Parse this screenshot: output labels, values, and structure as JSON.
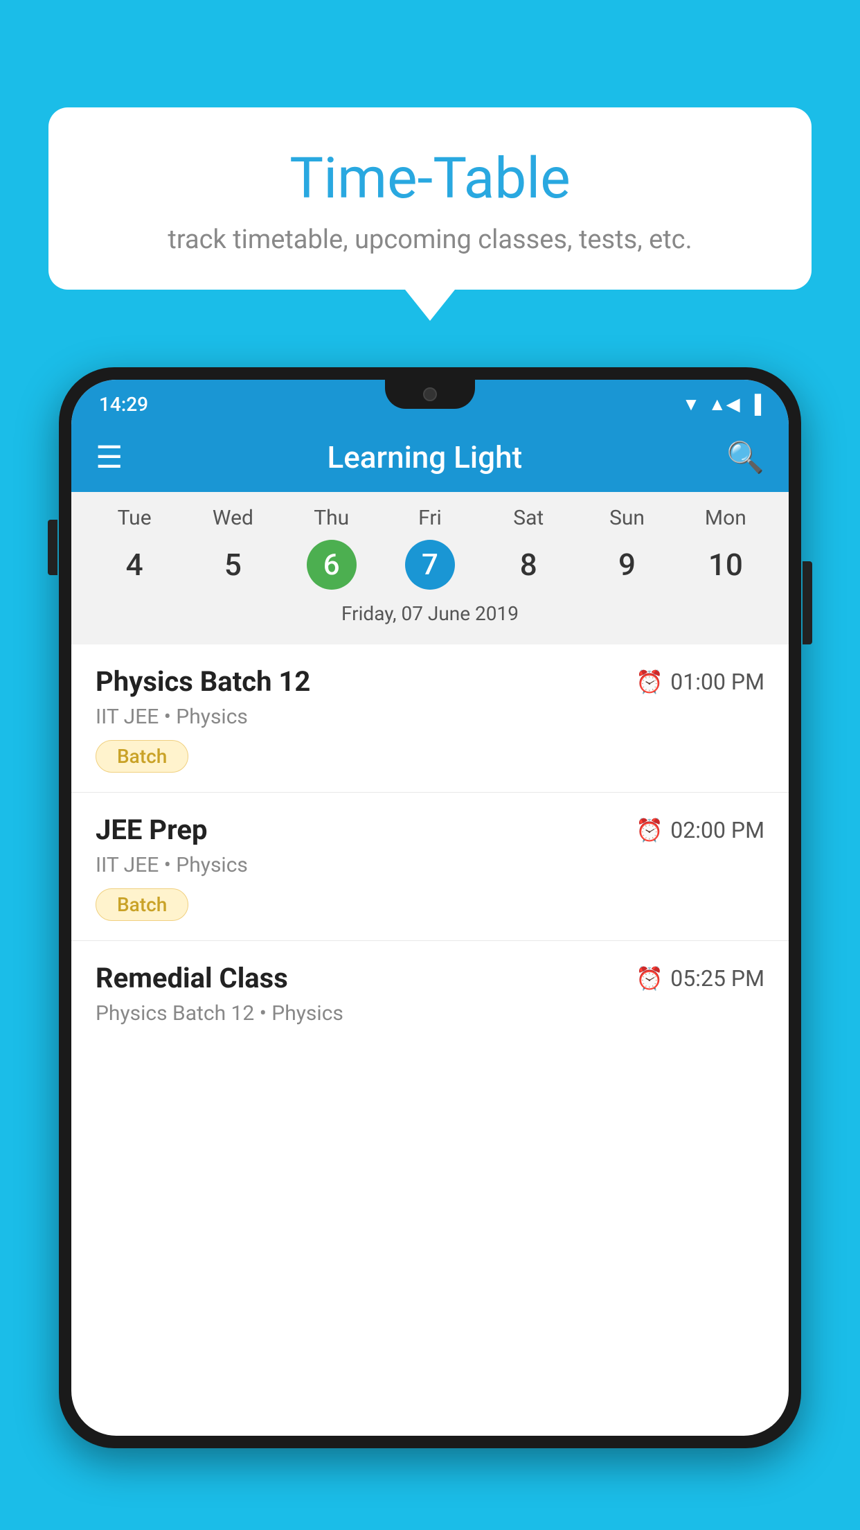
{
  "background_color": "#1BBDE8",
  "speech_bubble": {
    "title": "Time-Table",
    "subtitle": "track timetable, upcoming classes, tests, etc."
  },
  "phone": {
    "status_bar": {
      "time": "14:29",
      "icons": [
        "wifi",
        "signal",
        "battery"
      ]
    },
    "app_bar": {
      "title": "Learning Light",
      "menu_icon": "☰",
      "search_icon": "🔍"
    },
    "calendar": {
      "days": [
        {
          "label": "Tue",
          "num": "4"
        },
        {
          "label": "Wed",
          "num": "5"
        },
        {
          "label": "Thu",
          "num": "6",
          "state": "today"
        },
        {
          "label": "Fri",
          "num": "7",
          "state": "selected"
        },
        {
          "label": "Sat",
          "num": "8"
        },
        {
          "label": "Sun",
          "num": "9"
        },
        {
          "label": "Mon",
          "num": "10"
        }
      ],
      "selected_date": "Friday, 07 June 2019"
    },
    "schedule": [
      {
        "title": "Physics Batch 12",
        "time": "01:00 PM",
        "meta": "IIT JEE • Physics",
        "badge": "Batch"
      },
      {
        "title": "JEE Prep",
        "time": "02:00 PM",
        "meta": "IIT JEE • Physics",
        "badge": "Batch"
      },
      {
        "title": "Remedial Class",
        "time": "05:25 PM",
        "meta": "Physics Batch 12 • Physics",
        "badge": null
      }
    ]
  }
}
